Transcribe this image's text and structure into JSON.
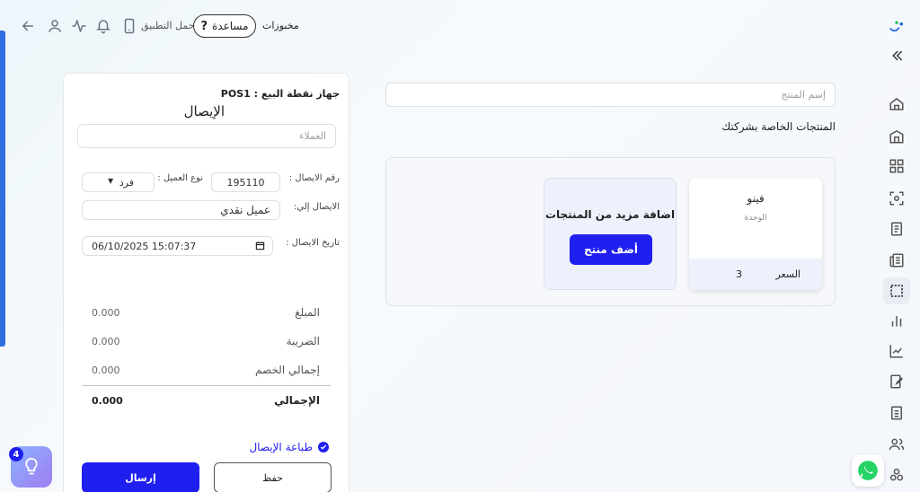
{
  "topbar": {
    "stores": "مخبوزات",
    "help": "مساعدة",
    "help_glyph": "?",
    "app_download": "حمل التطبيق"
  },
  "products": {
    "search_placeholder": "إسم المنتج",
    "section_title": "المنتجات الخاصة بشركتك",
    "items": [
      {
        "name": "فينو",
        "unit": "الوحدة",
        "price_label": "السعر",
        "price": "3"
      }
    ],
    "add_more_title": "اضافة مزيد من المنتجات",
    "add_button": "أضف منتج"
  },
  "receipt": {
    "pos_label": "جهاز نقطة البيع : POS1",
    "title": "الإيصال",
    "customers_placeholder": "العملاء",
    "receipt_number_label": "رقم الايصال :",
    "receipt_number": "195110",
    "customer_type_label": "نوع العميل :",
    "customer_type": "فرد",
    "receipt_to_label": "الايصال إلي:",
    "receipt_to": "عميل نقدي",
    "date_label": "تاريخ الايصال :",
    "date": "06/10/2025 15:07:37",
    "amount_label": "المبلغ",
    "amount": "0.000",
    "tax_label": "الضريبة",
    "tax": "0.000",
    "discount_label": "إجمالي الخصم",
    "discount": "0.000",
    "total_label": "الإجمالي",
    "total": "0.000",
    "print_receipt": "طباعة الإيصال",
    "save": "حفظ",
    "send": "إرسال"
  },
  "tips": {
    "badge": "4"
  },
  "colors": {
    "primary": "#1f1ff0",
    "accent_bar": "#2f6fe0",
    "whatsapp": "#25d366"
  }
}
